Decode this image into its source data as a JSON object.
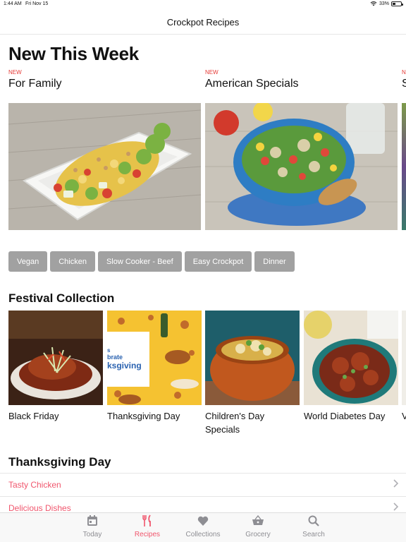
{
  "status": {
    "time": "1:44 AM",
    "date": "Fri Nov 15",
    "battery": "33%",
    "battery_level": 0.33
  },
  "nav": {
    "title": "Crockpot Recipes"
  },
  "new_this_week": {
    "heading": "New This Week",
    "cards": [
      {
        "tag": "NEW",
        "title": "For Family"
      },
      {
        "tag": "NEW",
        "title": "American Specials"
      },
      {
        "tag": "N",
        "title": "S"
      }
    ]
  },
  "tags": [
    "Vegan",
    "Chicken",
    "Slow Cooker - Beef",
    "Easy Crockpot",
    "Dinner"
  ],
  "festival": {
    "heading": "Festival Collection",
    "items": [
      {
        "label": "Black Friday"
      },
      {
        "label": "Thanksgiving Day",
        "image_text_1": "s",
        "image_text_2": "brate",
        "image_text_3": "ksgiving"
      },
      {
        "label": "Children's Day Specials"
      },
      {
        "label": "World Diabetes Day"
      },
      {
        "label": "V"
      }
    ]
  },
  "thanksgiving": {
    "heading": "Thanksgiving Day",
    "items": [
      "Tasty Chicken",
      "Delicious Dishes"
    ]
  },
  "tab_bar": {
    "tabs": [
      {
        "label": "Today",
        "icon": "calendar-icon"
      },
      {
        "label": "Recipes",
        "icon": "fork-knife-icon",
        "active": true
      },
      {
        "label": "Collections",
        "icon": "heart-icon"
      },
      {
        "label": "Grocery",
        "icon": "basket-icon"
      },
      {
        "label": "Search",
        "icon": "search-icon"
      }
    ]
  },
  "colors": {
    "accent": "#f0566d",
    "new_tag": "#e53935",
    "chip": "#a1a1a1"
  }
}
